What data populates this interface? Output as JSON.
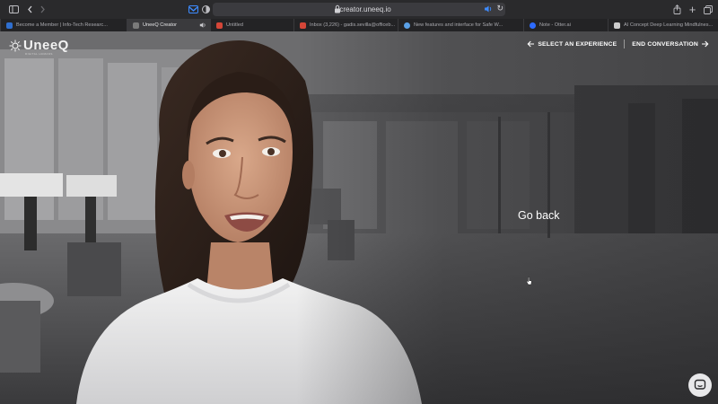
{
  "browser": {
    "url": "creator.uneeq.io",
    "tabs": [
      {
        "title": "Become a Member | Info-Tech Researc...",
        "favicon_color": "#2f6fcf",
        "active": false,
        "muted_icon": false
      },
      {
        "title": "UneeQ Creator",
        "favicon_color": "#7a7a7a",
        "active": true,
        "muted_icon": true
      },
      {
        "title": "Untitled",
        "favicon_color": "#d44638",
        "active": false,
        "muted_icon": false
      },
      {
        "title": "Inbox (3,226) - gadis.sevilla@officeb...",
        "favicon_color": "#d44638",
        "active": false,
        "muted_icon": false
      },
      {
        "title": "New features and interface for Safe W...",
        "favicon_color": "#5aa0e6",
        "active": false,
        "muted_icon": false
      },
      {
        "title": "Note - Otter.ai",
        "favicon_color": "#2d6bff",
        "active": false,
        "muted_icon": false
      },
      {
        "title": "AI Concept Deep Learning Mindfulnes...",
        "favicon_color": "#cccccc",
        "active": false,
        "muted_icon": false
      }
    ]
  },
  "app": {
    "logo_text": "UneeQ",
    "logo_sub": "DIGITAL HUMANS"
  },
  "nav": {
    "select_experience": "SELECT AN EXPERIENCE",
    "end_conversation": "END CONVERSATION"
  },
  "main": {
    "go_back": "Go back"
  },
  "colors": {
    "nav_text": "#ffffff",
    "chat_button_bg": "#e8e8ea",
    "chrome_bg": "#2a2a2c"
  }
}
